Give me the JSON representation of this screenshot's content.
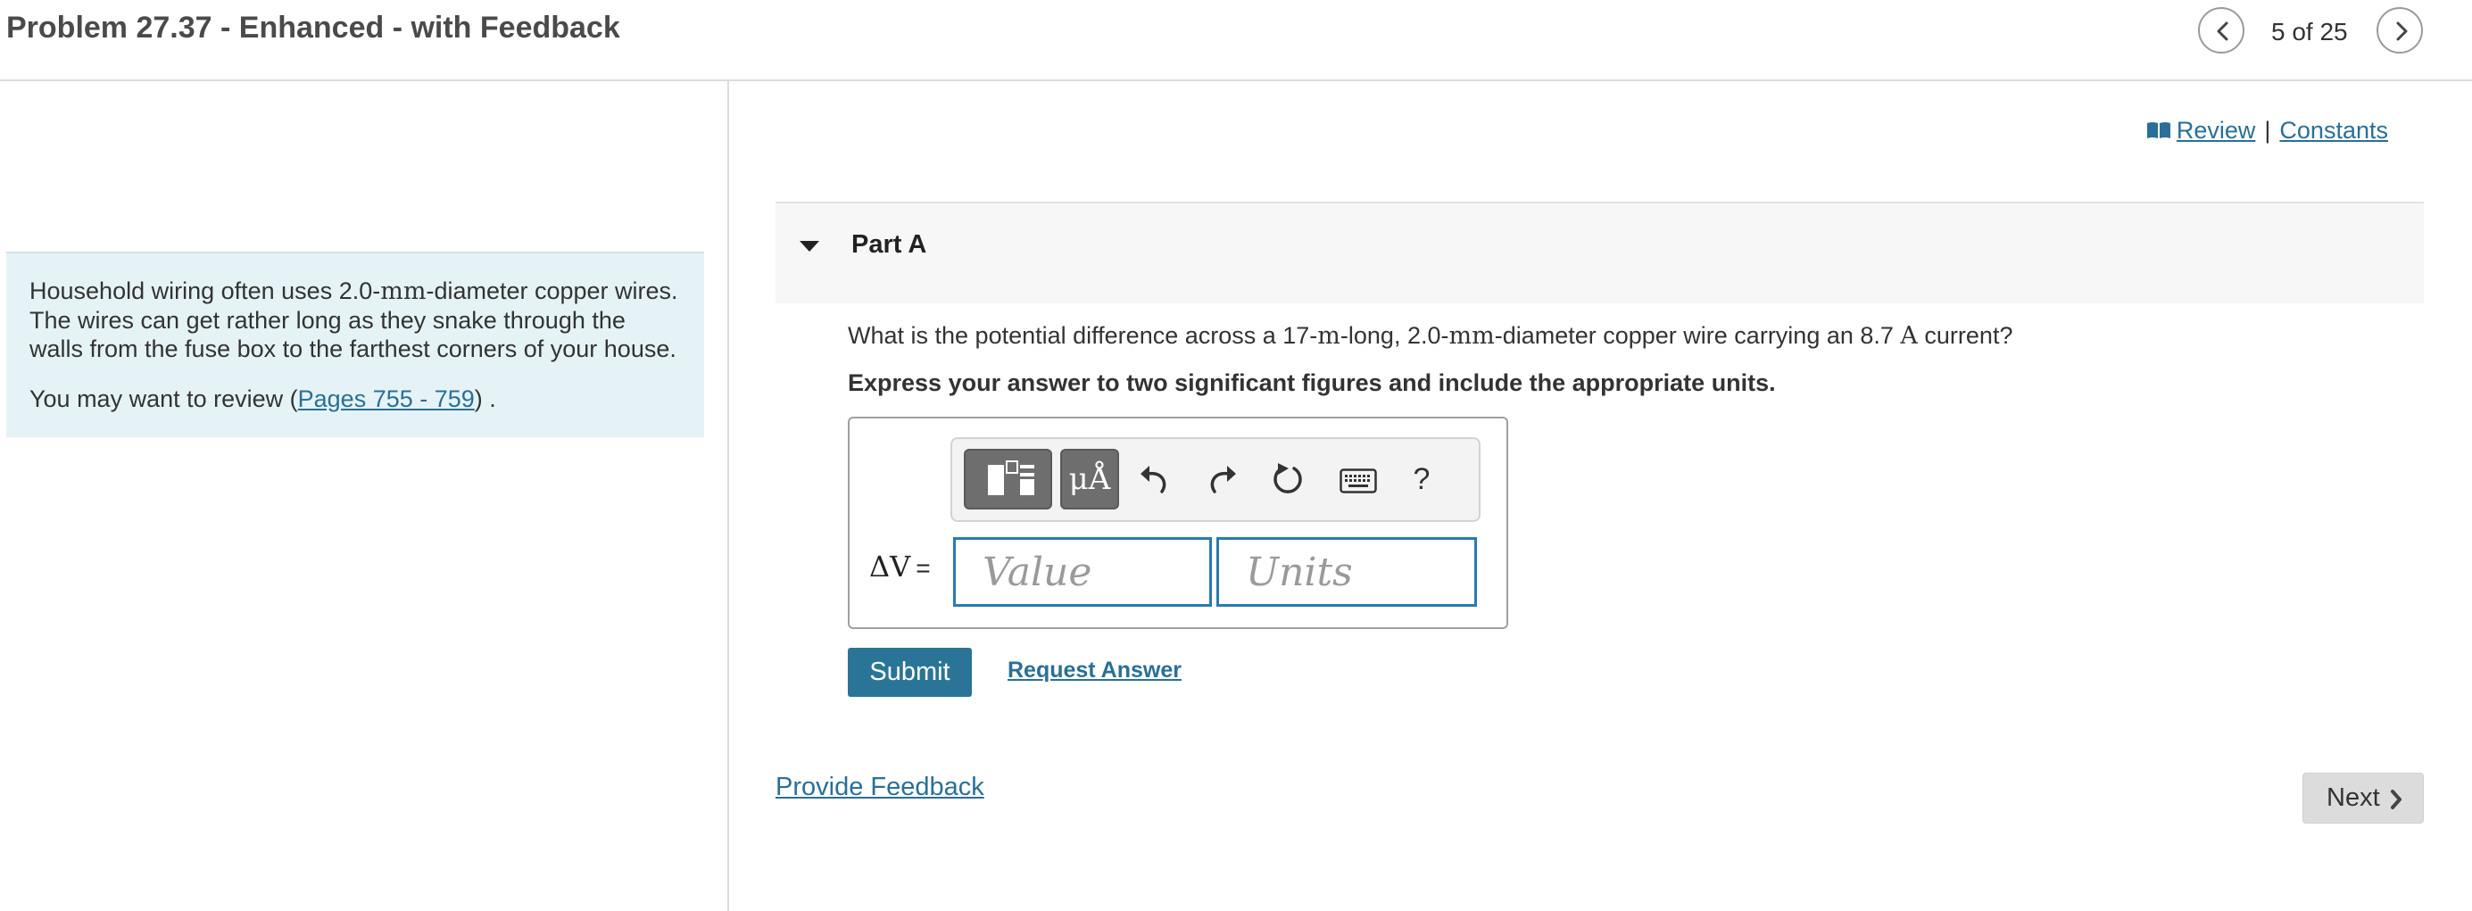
{
  "header": {
    "title": "Problem 27.37 - Enhanced - with Feedback",
    "pager": "5 of 25"
  },
  "intro": {
    "text_pre": "Household wiring often uses 2.0-",
    "unit_mm": "mm",
    "text_post": "-diameter copper wires. The wires can get rather long as they snake through the walls from the fuse box to the farthest corners of your house.",
    "review_pre": "You may want to review (",
    "review_link": "Pages 755 - 759",
    "review_post": ") ."
  },
  "resources": {
    "review": "Review",
    "separator": "|",
    "constants": "Constants"
  },
  "part": {
    "label": "Part A",
    "question_1": "What is the potential difference across a 17-",
    "unit_m": "m",
    "question_2": "-long, 2.0-",
    "unit_mm": "mm",
    "question_3": "-diameter copper wire carrying an 8.7 ",
    "unit_A": "A",
    "question_4": " current?",
    "instruction": "Express your answer to two significant figures and include the appropriate units."
  },
  "toolbar": {
    "units_button": "μÅ",
    "help": "?",
    "icons": [
      "templates-icon",
      "units-icon",
      "undo-icon",
      "redo-icon",
      "reset-icon",
      "keyboard-icon",
      "help-icon"
    ]
  },
  "answer": {
    "variable": "ΔV",
    "equals": "=",
    "value_placeholder": "Value",
    "units_placeholder": "Units",
    "value": "",
    "units": ""
  },
  "actions": {
    "submit": "Submit",
    "request_answer": "Request Answer",
    "provide_feedback": "Provide Feedback",
    "next": "Next"
  },
  "colors": {
    "accent": "#2a7597",
    "link": "#2a6f97",
    "intro_bg": "#e6f3f6",
    "field_border": "#2a7ab0"
  }
}
